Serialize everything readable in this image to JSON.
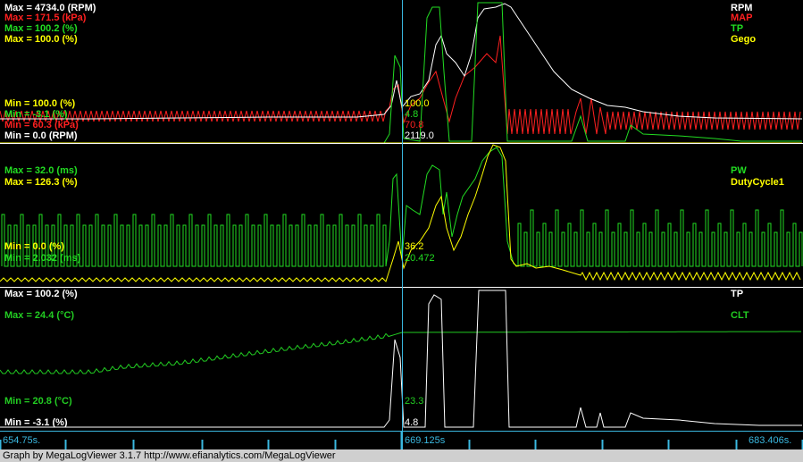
{
  "colors": {
    "rpm": "#ffffff",
    "map": "#ff2020",
    "tp": "#22dd22",
    "gego": "#ffff00",
    "pw": "#22dd22",
    "duty": "#ffff00",
    "tp3": "#ffffff",
    "clt": "#22cc22",
    "cursor": "#3ab8e0",
    "divider": "#ffffff",
    "timeline_text": "#3ab8e0"
  },
  "panels": [
    {
      "max_labels": [
        {
          "text": "Max = 4734.0 (RPM)",
          "color": "#ffffff"
        },
        {
          "text": "Max = 171.5 (kPa)",
          "color": "#ff2020"
        },
        {
          "text": "Max = 100.2 (%)",
          "color": "#22dd22"
        },
        {
          "text": "Max = 100.0 (%)",
          "color": "#ffff00"
        }
      ],
      "min_labels": [
        {
          "text": "Min = 100.0 (%)",
          "color": "#ffff00"
        },
        {
          "text": "Min = -3.1 (%)",
          "color": "#22dd22"
        },
        {
          "text": "Min = 60.3 (kPa)",
          "color": "#ff2020"
        },
        {
          "text": "Min = 0.0 (RPM)",
          "color": "#ffffff"
        }
      ],
      "legend": [
        {
          "text": "RPM",
          "color": "#ffffff"
        },
        {
          "text": "MAP",
          "color": "#ff2020"
        },
        {
          "text": "TP",
          "color": "#22dd22"
        },
        {
          "text": "Gego",
          "color": "#ffff00"
        }
      ],
      "cursor_values": [
        {
          "text": "100.0",
          "color": "#ffff00"
        },
        {
          "text": "4.8",
          "color": "#22dd22"
        },
        {
          "text": "70.8",
          "color": "#ff2020"
        },
        {
          "text": "2119.0",
          "color": "#ffffff"
        }
      ]
    },
    {
      "max_labels": [
        {
          "text": "Max = 32.0 (ms)",
          "color": "#22dd22"
        },
        {
          "text": "Max = 126.3 (%)",
          "color": "#ffff00"
        }
      ],
      "min_labels": [
        {
          "text": "Min = 0.0 (%)",
          "color": "#ffff00"
        },
        {
          "text": "Min = 2.032 (ms)",
          "color": "#22dd22"
        }
      ],
      "legend": [
        {
          "text": "PW",
          "color": "#22dd22"
        },
        {
          "text": "DutyCycle1",
          "color": "#ffff00"
        }
      ],
      "cursor_values": [
        {
          "text": "36.2",
          "color": "#ffff00"
        },
        {
          "text": "20.472",
          "color": "#22dd22"
        }
      ]
    },
    {
      "max_labels": [
        {
          "text": "Max = 100.2 (%)",
          "color": "#ffffff"
        },
        {
          "text": "Max = 24.4 (°C)",
          "color": "#22cc22"
        }
      ],
      "min_labels": [
        {
          "text": "Min = 20.8 (°C)",
          "color": "#22cc22"
        },
        {
          "text": "Min = -3.1 (%)",
          "color": "#ffffff"
        }
      ],
      "legend": [
        {
          "text": "TP",
          "color": "#ffffff"
        },
        {
          "text": "CLT",
          "color": "#22cc22"
        }
      ],
      "cursor_values": [
        {
          "text": "23.3",
          "color": "#22cc22"
        },
        {
          "text": "4.8",
          "color": "#ffffff"
        }
      ]
    }
  ],
  "timeline": {
    "start": "654.75s.",
    "cursor": "669.125s",
    "end": "683.406s."
  },
  "footer": "Graph by MegaLogViewer 3.1.7 http://www.efianalytics.com/MegaLogViewer"
}
